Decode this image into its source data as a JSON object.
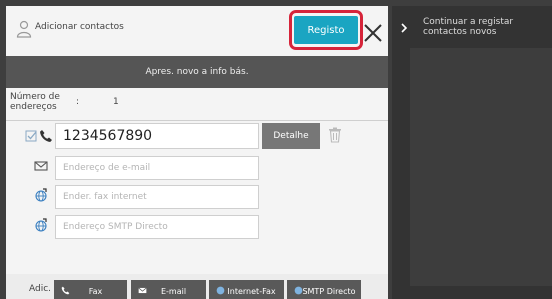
{
  "header": {
    "title": "Adicionar contactos",
    "registo_label": "Registo"
  },
  "info_bar": {
    "label": "Apres. novo a info bás."
  },
  "address_count": {
    "label": "Número de endereços",
    "separator": ":",
    "value": "1"
  },
  "fields": {
    "fax_number": "1234567890",
    "email_placeholder": "Endereço de e-mail",
    "internet_fax_placeholder": "Ender. fax internet",
    "smtp_placeholder": "Endereço SMTP Directo"
  },
  "detail_button": "Detalhe",
  "bottom_bar": {
    "adic_label": "Adic.",
    "buttons": [
      "Fax",
      "E-mail",
      "Internet-Fax",
      "SMTP Directo"
    ]
  },
  "side_panel": {
    "continue_label": "Continuar a registar contactos novos"
  },
  "colors": {
    "accent": "#1aa5c2",
    "highlight": "#d6243a"
  }
}
